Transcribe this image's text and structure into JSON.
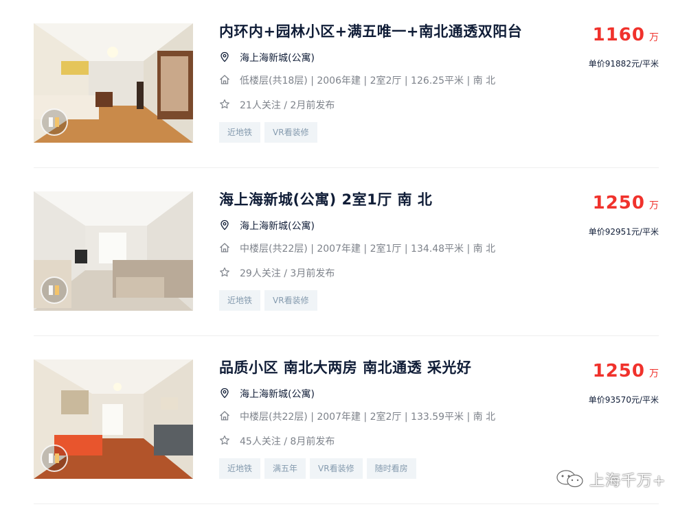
{
  "listings": [
    {
      "title": "内环内+园林小区+满五唯一+南北通透双阳台",
      "address": "海上海新城(公寓)",
      "info": "低楼层(共18层) | 2006年建 | 2室2厅 | 126.25平米 | 南 北",
      "follow": "21人关注 / 2月前发布",
      "tags": [
        "近地铁",
        "VR看装修"
      ],
      "price": "1160",
      "price_unit": "万",
      "unit_price": "单价91882元/平米"
    },
    {
      "title": "海上海新城(公寓) 2室1厅 南 北",
      "address": "海上海新城(公寓)",
      "info": "中楼层(共22层) | 2007年建 | 2室1厅 | 134.48平米 | 南 北",
      "follow": "29人关注 / 3月前发布",
      "tags": [
        "近地铁",
        "VR看装修"
      ],
      "price": "1250",
      "price_unit": "万",
      "unit_price": "单价92951元/平米"
    },
    {
      "title": "品质小区 南北大两房 南北通透 采光好",
      "address": "海上海新城(公寓)",
      "info": "中楼层(共22层) | 2007年建 | 2室2厅 | 133.59平米 | 南 北",
      "follow": "45人关注 / 8月前发布",
      "tags": [
        "近地铁",
        "满五年",
        "VR看装修",
        "随时看房"
      ],
      "price": "1250",
      "price_unit": "万",
      "unit_price": "单价93570元/平米"
    }
  ],
  "icons": {
    "address": "location-pin-icon",
    "info": "house-icon",
    "follow": "star-icon",
    "vr": "vr-panorama-icon"
  },
  "watermark": "上海千万+",
  "colors": {
    "price": "#f0322c",
    "title": "#101d37",
    "tag_bg": "#f0f4f7",
    "tag_text": "#849aae"
  }
}
